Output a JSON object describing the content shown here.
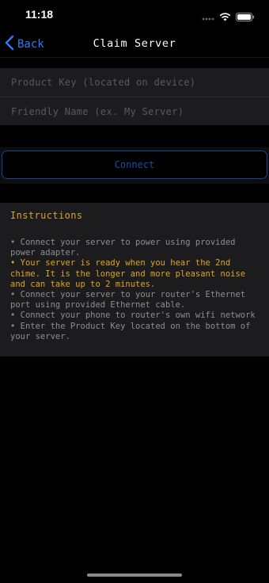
{
  "status_bar": {
    "time": "11:18"
  },
  "nav": {
    "back_label": "Back",
    "title": "Claim Server"
  },
  "form": {
    "product_key": {
      "placeholder": "Product Key (located on device)",
      "value": ""
    },
    "friendly_name": {
      "placeholder": "Friendly Name (ex. My Server)",
      "value": ""
    }
  },
  "connect_label": "Connect",
  "instructions": {
    "title": "Instructions",
    "items": [
      "• Connect your server to power using provided power adapter.",
      "• Your server is ready when you hear the 2nd chime. It is the longer and more pleasant noise and can take up to 2 minutes.",
      "• Connect your server to your router's Ethernet port using provided Ethernet cable.",
      "• Connect your phone to router's own wifi network",
      "• Enter the Product Key located on the bottom of your server."
    ]
  },
  "colors": {
    "accent": "#3478f6",
    "instructions_title": "#d9a323",
    "highlight_text": "#e0a51c",
    "connect_border": "#1a3f99"
  }
}
